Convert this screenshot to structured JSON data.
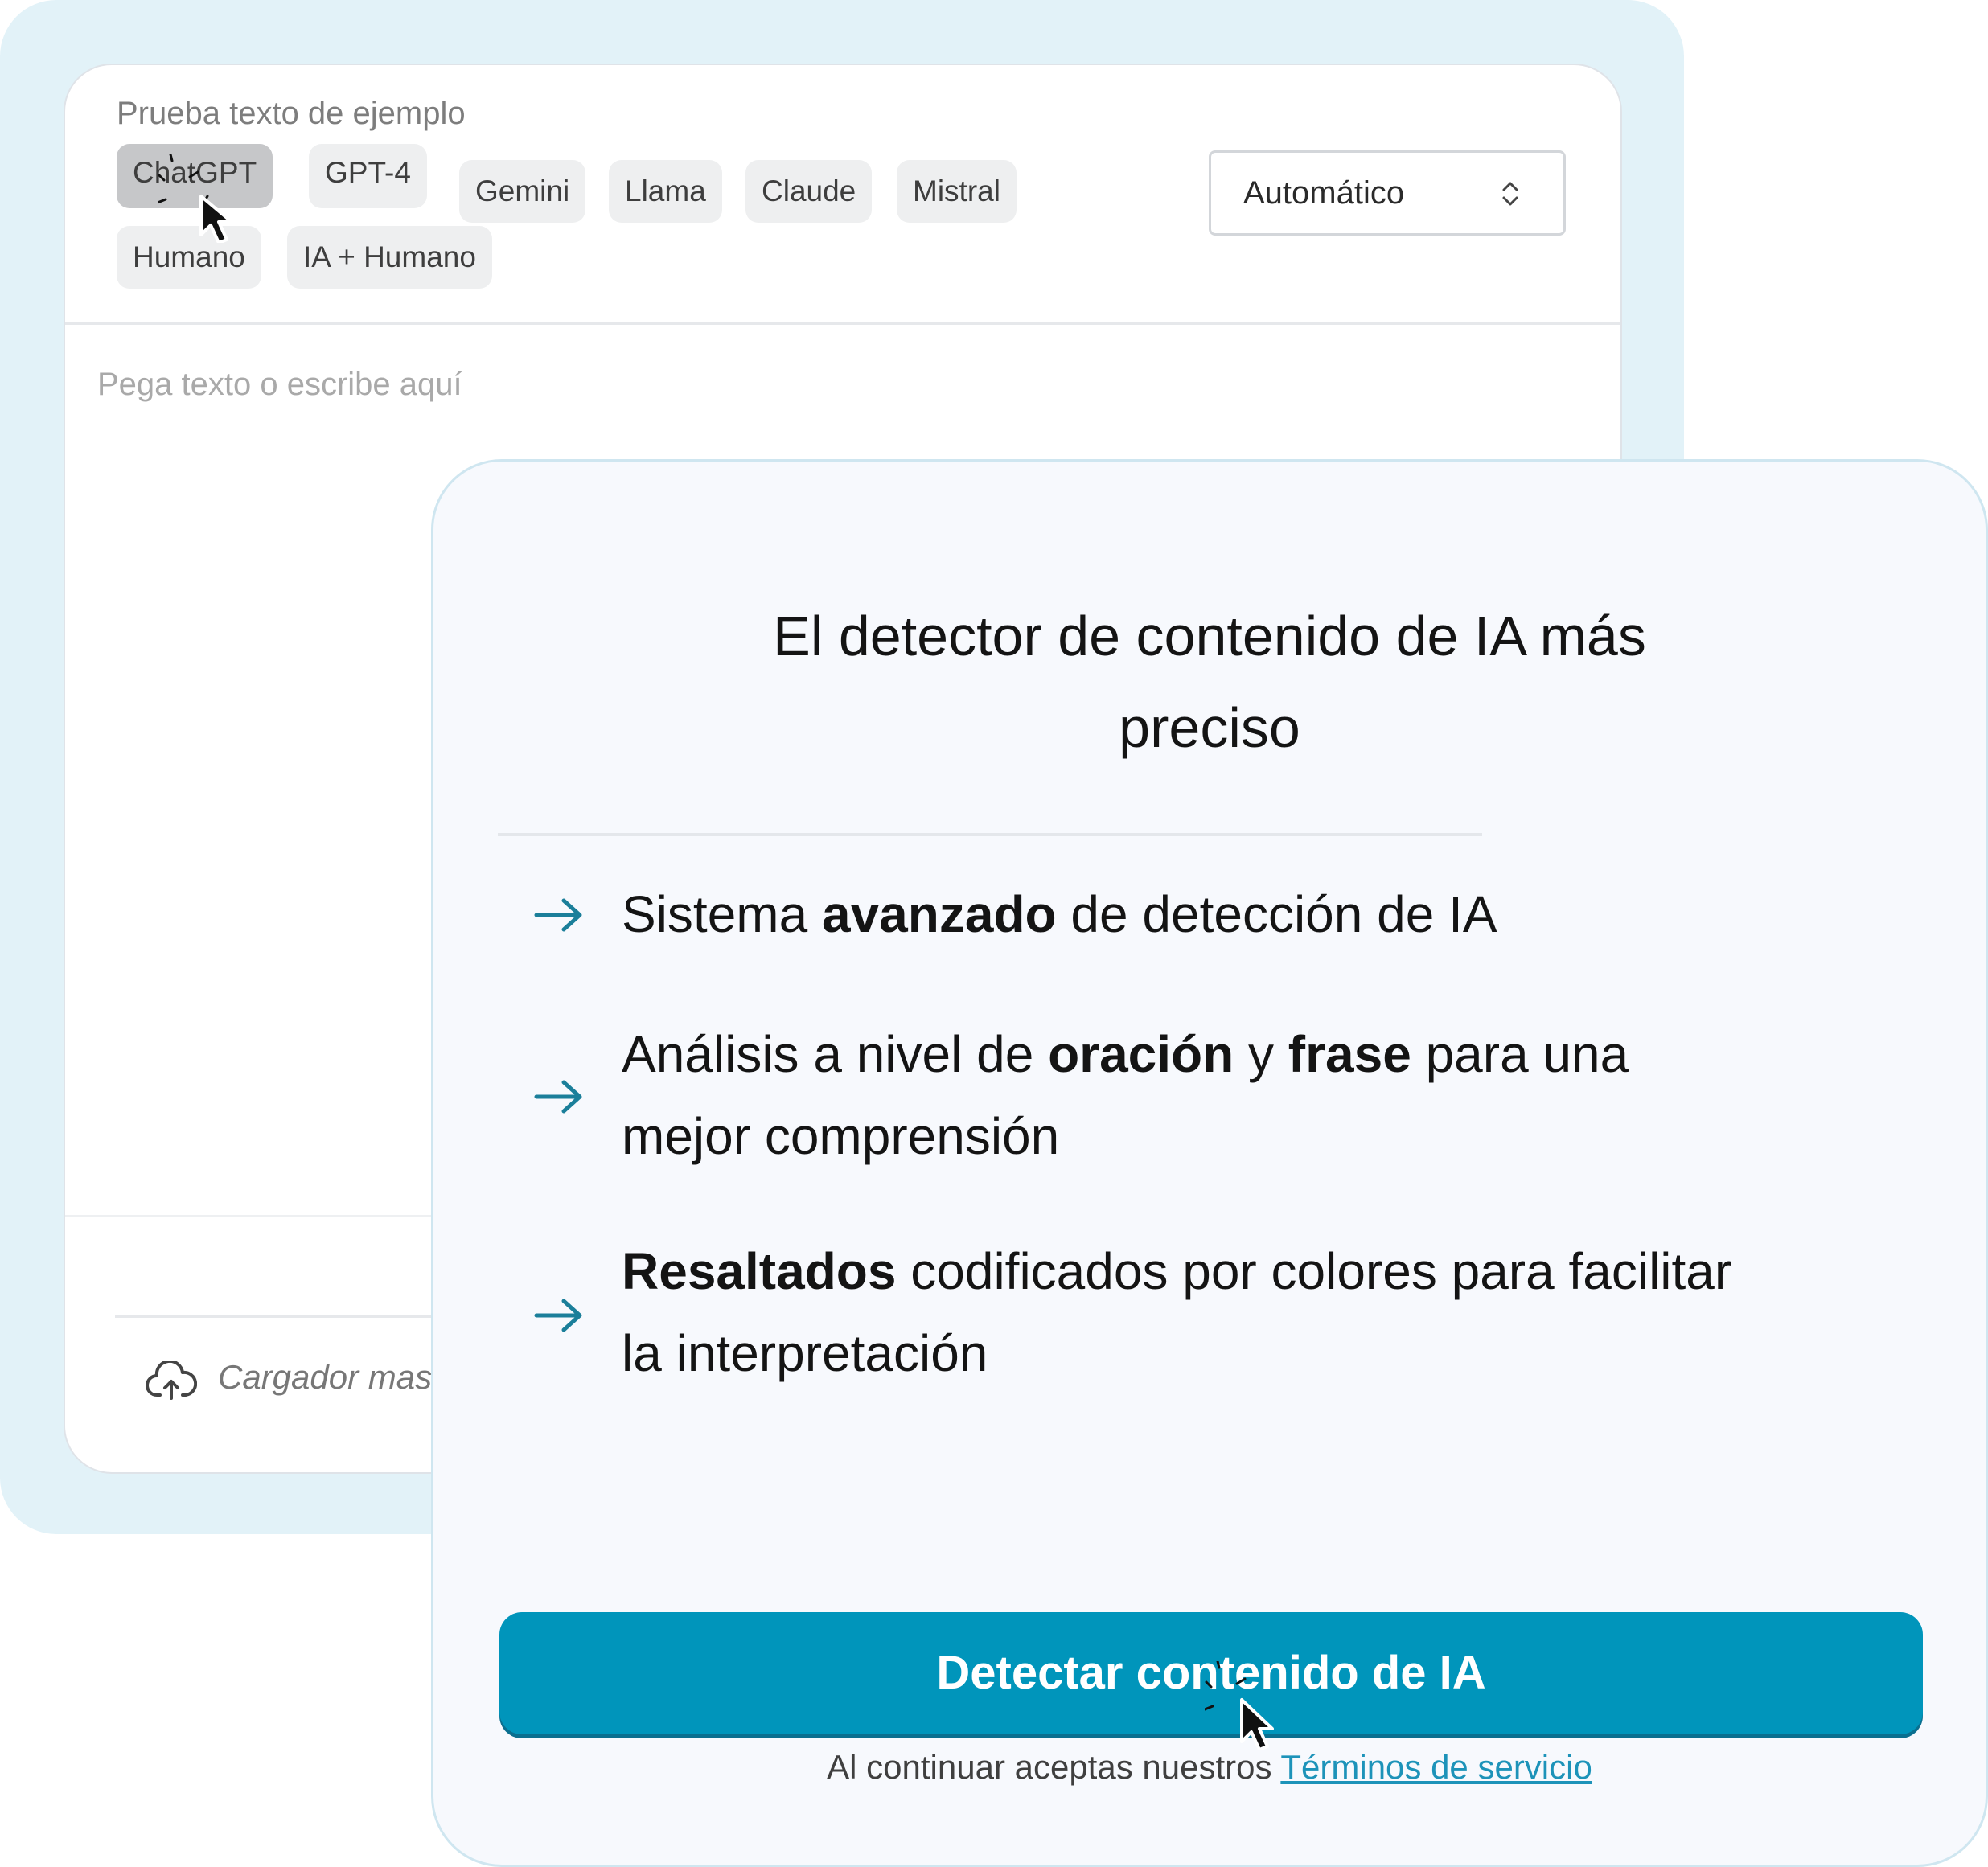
{
  "editor": {
    "sample_label": "Prueba texto de ejemplo",
    "chips": [
      "ChatGPT",
      "GPT-4",
      "Gemini",
      "Llama",
      "Claude",
      "Mistral",
      "Humano",
      "IA + Humano"
    ],
    "mode_select": {
      "value": "Automático",
      "icon": "chevron-updown-icon"
    },
    "placeholder": "Pega texto o escribe aquí",
    "upload_label": "Cargador masivo",
    "upload_icon": "cloud-upload-icon"
  },
  "card": {
    "title_line1": "El detector de contenido de IA más",
    "title_line2": "preciso",
    "features": [
      {
        "pre": "Sistema ",
        "bold": "avanzado",
        "post": " de detección de IA"
      },
      {
        "pre": "Análisis a nivel de ",
        "bold1": "oración",
        "mid": " y ",
        "bold2": "frase",
        "post1": " para una",
        "line2": "mejor comprensión"
      },
      {
        "bold": "Resaltados",
        "post": " codificados por colores para facilitar",
        "line2": "la interpretación"
      }
    ],
    "button_label": "Detectar contenido de IA",
    "terms_text": "Al continuar aceptas nuestros ",
    "terms_link": "Términos de servicio"
  },
  "colors": {
    "accent": "#0095bb",
    "frame": "#e2f2f8",
    "link": "#1d93b9"
  }
}
